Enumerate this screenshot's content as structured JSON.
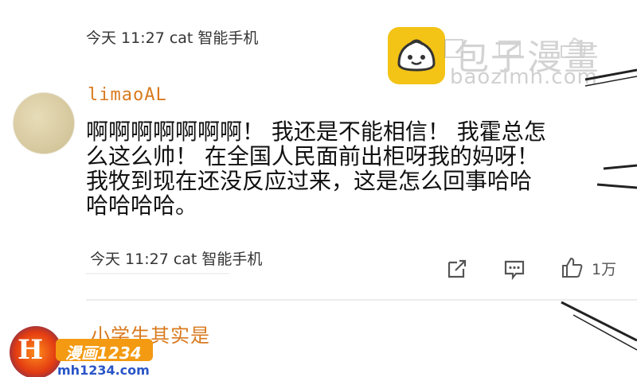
{
  "comment_1": {
    "meta": "今天 11:27 cat 智能手机"
  },
  "comment_2": {
    "username": "limaoAL",
    "text_lines": [
      "啊啊啊啊啊啊啊！ 我还是不能相信！ 我霍总怎",
      "么这么帅！ 在全国人民面前出柜呀我的妈呀！",
      "我牧到现在还没反应过来，这是怎么回事哈哈",
      "哈哈哈哈。"
    ],
    "meta": "今天 11:27 cat 智能手机",
    "like_count": "1万",
    "icons": [
      "share-icon",
      "comment-icon",
      "like-icon"
    ]
  },
  "comment_3": {
    "username": "小学生其实是"
  },
  "watermark": {
    "title": "包子漫畫",
    "url": "baozimh.com"
  },
  "site_logo": {
    "badge": "漫画1234",
    "url": "mh1234.com"
  },
  "colors": {
    "username": "#d97a1e",
    "logo_yellow": "#f3c316",
    "badge_orange": "#f39a12",
    "link_blue": "#2a55c7"
  }
}
